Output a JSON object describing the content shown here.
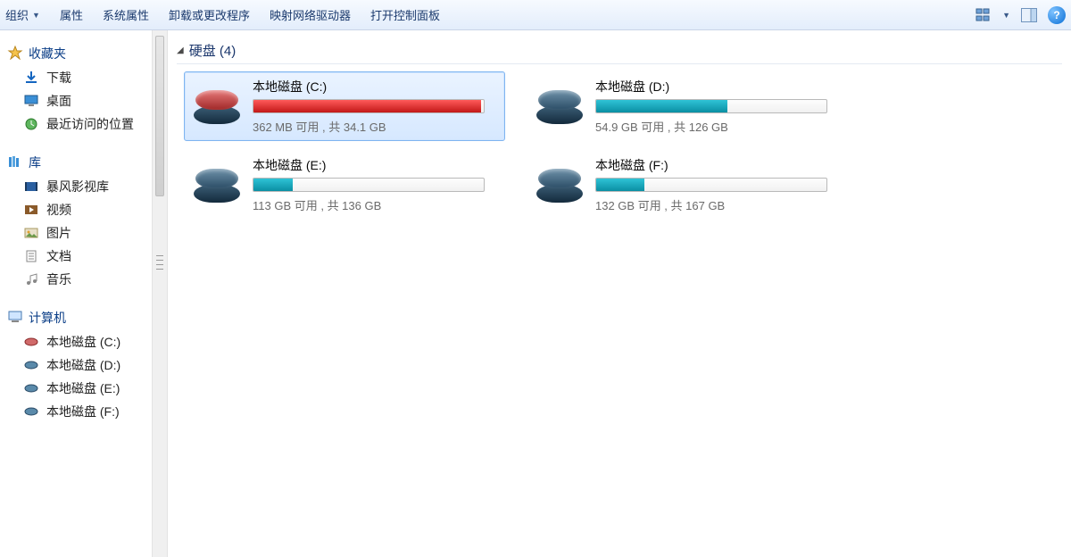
{
  "toolbar": {
    "organize": "组织",
    "properties": "属性",
    "system_properties": "系统属性",
    "uninstall_change": "卸载或更改程序",
    "map_drive": "映射网络驱动器",
    "open_control_panel": "打开控制面板"
  },
  "sidebar": {
    "favorites": {
      "title": "收藏夹",
      "items": [
        "下载",
        "桌面",
        "最近访问的位置"
      ]
    },
    "libraries": {
      "title": "库",
      "items": [
        "暴风影视库",
        "视频",
        "图片",
        "文档",
        "音乐"
      ]
    },
    "computer": {
      "title": "计算机",
      "items": [
        "本地磁盘 (C:)",
        "本地磁盘 (D:)",
        "本地磁盘 (E:)",
        "本地磁盘 (F:)"
      ]
    }
  },
  "main": {
    "section_title": "硬盘 (4)",
    "drives": [
      {
        "name": "本地磁盘 (C:)",
        "stat": "362 MB 可用 , 共 34.1 GB",
        "fill": 99,
        "color": "red",
        "selected": true
      },
      {
        "name": "本地磁盘 (D:)",
        "stat": "54.9 GB 可用 , 共 126 GB",
        "fill": 57,
        "color": "teal",
        "selected": false
      },
      {
        "name": "本地磁盘 (E:)",
        "stat": "113 GB 可用 , 共 136 GB",
        "fill": 17,
        "color": "teal",
        "selected": false
      },
      {
        "name": "本地磁盘 (F:)",
        "stat": "132 GB 可用 , 共 167 GB",
        "fill": 21,
        "color": "teal",
        "selected": false
      }
    ]
  }
}
